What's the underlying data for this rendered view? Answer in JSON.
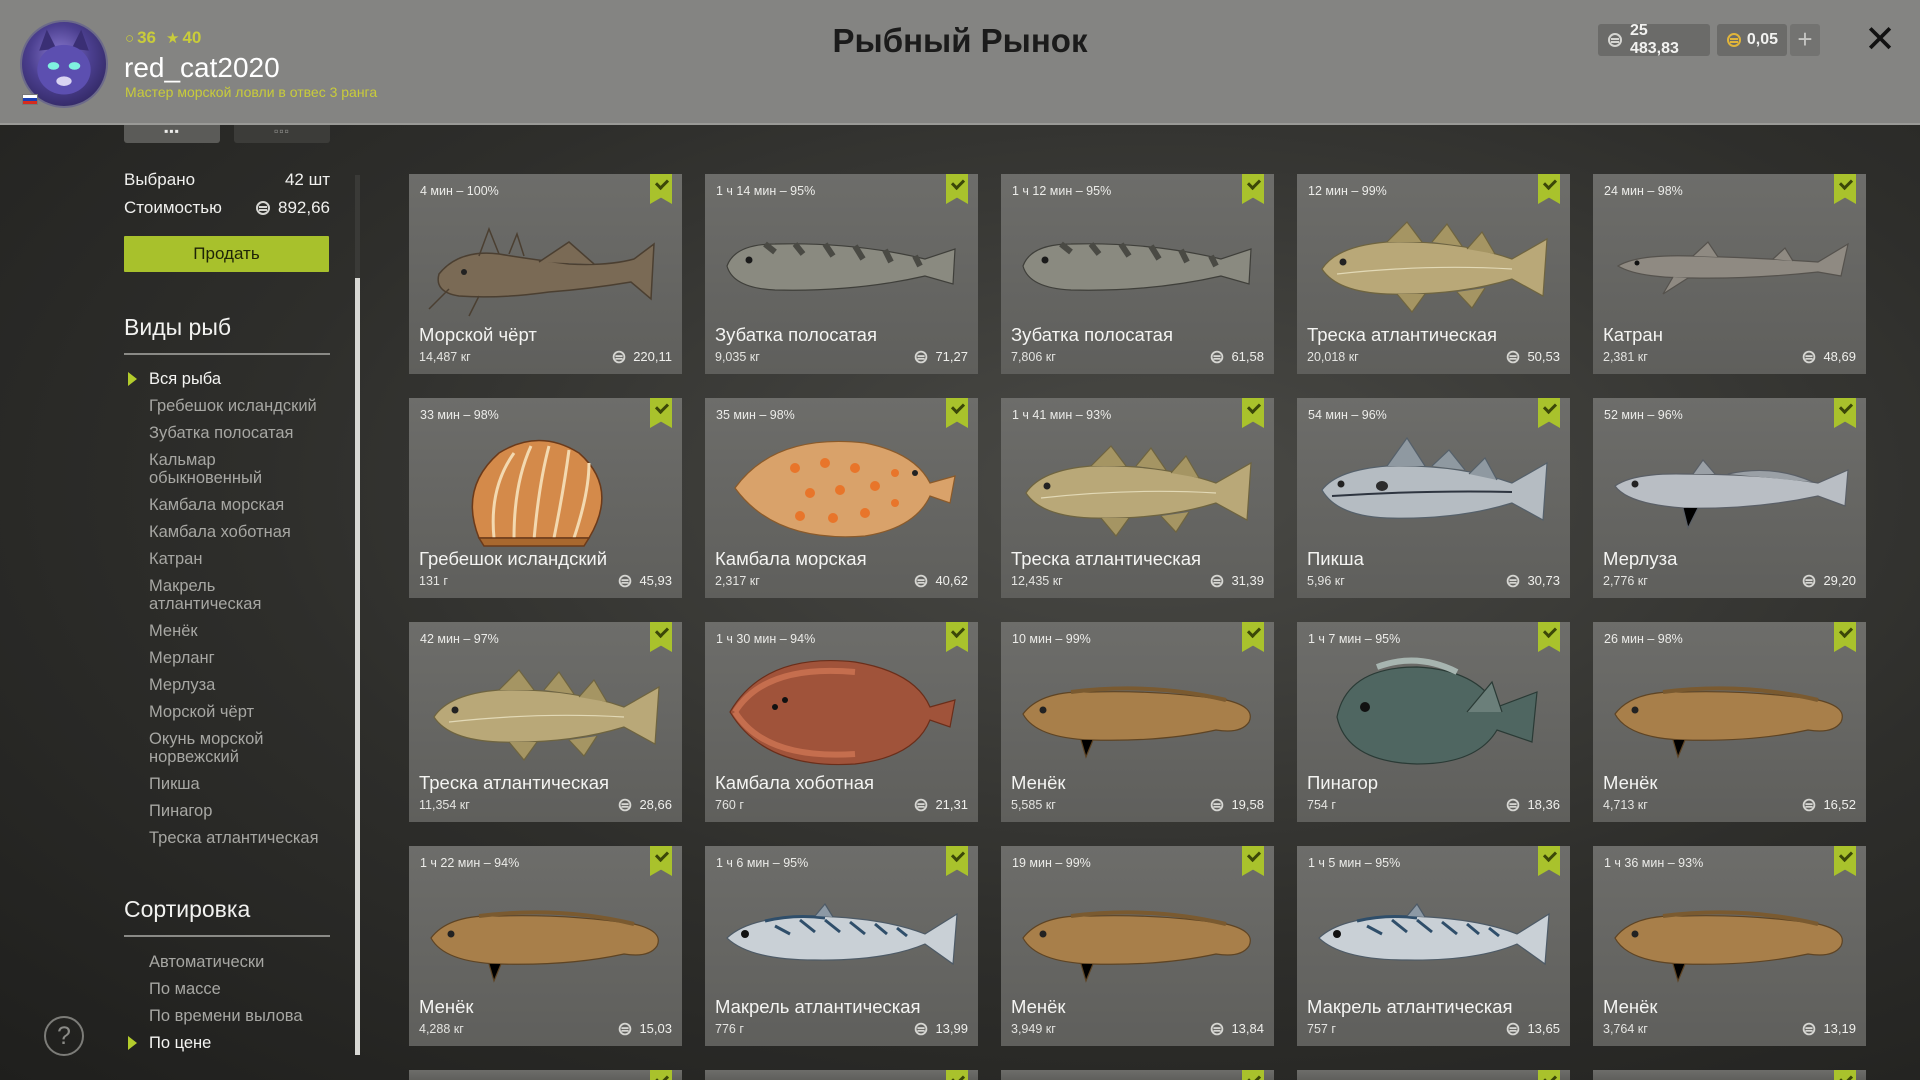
{
  "header": {
    "title": "Рыбный Рынок",
    "username": "red_cat2020",
    "rank": "Мастер морской ловли в отвес 3 ранга",
    "level": "36",
    "stars": "40",
    "money": "25 483,83",
    "gold": "0,05",
    "plus_label": "+",
    "close_label": "✕"
  },
  "sidebar": {
    "view_tab_grid": "▪▪▪",
    "view_tab_small": "▫▫▫",
    "selected_label": "Выбрано",
    "selected_value": "42 шт",
    "cost_label": "Стоимостью",
    "cost_value": "892,66",
    "sell_label": "Продать",
    "species_heading": "Виды рыб",
    "species": [
      "Вся рыба",
      "Гребешок исландский",
      "Зубатка полосатая",
      "Кальмар обыкновенный",
      "Камбала морская",
      "Камбала хоботная",
      "Катран",
      "Макрель атлантическая",
      "Менёк",
      "Мерланг",
      "Мерлуза",
      "Морской чёрт",
      "Окунь морской норвежский",
      "Пикша",
      "Пинагор",
      "Треска атлантическая"
    ],
    "sort_heading": "Сортировка",
    "sort": [
      "Автоматически",
      "По массе",
      "По времени вылова",
      "По цене"
    ],
    "help_label": "?"
  },
  "colors": {
    "accent": "#a9c22c",
    "header_bg": "#848482",
    "card_bg": "#666663"
  },
  "cards": [
    {
      "time": "4 мин – 100%",
      "name": "Морской чёрт",
      "weight": "14,487 кг",
      "price": "220,11",
      "fish": "monkfish"
    },
    {
      "time": "1 ч 14 мин – 95%",
      "name": "Зубатка полосатая",
      "weight": "9,035 кг",
      "price": "71,27",
      "fish": "wolffish"
    },
    {
      "time": "1 ч 12 мин – 95%",
      "name": "Зубатка полосатая",
      "weight": "7,806 кг",
      "price": "61,58",
      "fish": "wolffish"
    },
    {
      "time": "12 мин – 99%",
      "name": "Треска атлантическая",
      "weight": "20,018 кг",
      "price": "50,53",
      "fish": "cod"
    },
    {
      "time": "24 мин – 98%",
      "name": "Катран",
      "weight": "2,381 кг",
      "price": "48,69",
      "fish": "dogfish"
    },
    {
      "time": "33 мин – 98%",
      "name": "Гребешок исландский",
      "weight": "131 г",
      "price": "45,93",
      "fish": "scallop"
    },
    {
      "time": "35 мин – 98%",
      "name": "Камбала морская",
      "weight": "2,317 кг",
      "price": "40,62",
      "fish": "plaice"
    },
    {
      "time": "1 ч 41 мин – 93%",
      "name": "Треска атлантическая",
      "weight": "12,435 кг",
      "price": "31,39",
      "fish": "cod"
    },
    {
      "time": "54 мин – 96%",
      "name": "Пикша",
      "weight": "5,96 кг",
      "price": "30,73",
      "fish": "haddock"
    },
    {
      "time": "52 мин – 96%",
      "name": "Мерлуза",
      "weight": "2,776 кг",
      "price": "29,20",
      "fish": "hake"
    },
    {
      "time": "42 мин – 97%",
      "name": "Треска атлантическая",
      "weight": "11,354 кг",
      "price": "28,66",
      "fish": "cod"
    },
    {
      "time": "1 ч 30 мин – 94%",
      "name": "Камбала хоботная",
      "weight": "760 г",
      "price": "21,31",
      "fish": "flounder"
    },
    {
      "time": "10 мин – 99%",
      "name": "Менёк",
      "weight": "5,585 кг",
      "price": "19,58",
      "fish": "tusk"
    },
    {
      "time": "1 ч 7 мин – 95%",
      "name": "Пинагор",
      "weight": "754 г",
      "price": "18,36",
      "fish": "lumpfish"
    },
    {
      "time": "26 мин – 98%",
      "name": "Менёк",
      "weight": "4,713 кг",
      "price": "16,52",
      "fish": "tusk"
    },
    {
      "time": "1 ч 22 мин – 94%",
      "name": "Менёк",
      "weight": "4,288 кг",
      "price": "15,03",
      "fish": "tusk"
    },
    {
      "time": "1 ч 6 мин – 95%",
      "name": "Макрель атлантическая",
      "weight": "776 г",
      "price": "13,99",
      "fish": "mackerel"
    },
    {
      "time": "19 мин – 99%",
      "name": "Менёк",
      "weight": "3,949 кг",
      "price": "13,84",
      "fish": "tusk"
    },
    {
      "time": "1 ч 5 мин – 95%",
      "name": "Макрель атлантическая",
      "weight": "757 г",
      "price": "13,65",
      "fish": "mackerel"
    },
    {
      "time": "1 ч 36 мин – 93%",
      "name": "Менёк",
      "weight": "3,764 кг",
      "price": "13,19",
      "fish": "tusk"
    }
  ]
}
